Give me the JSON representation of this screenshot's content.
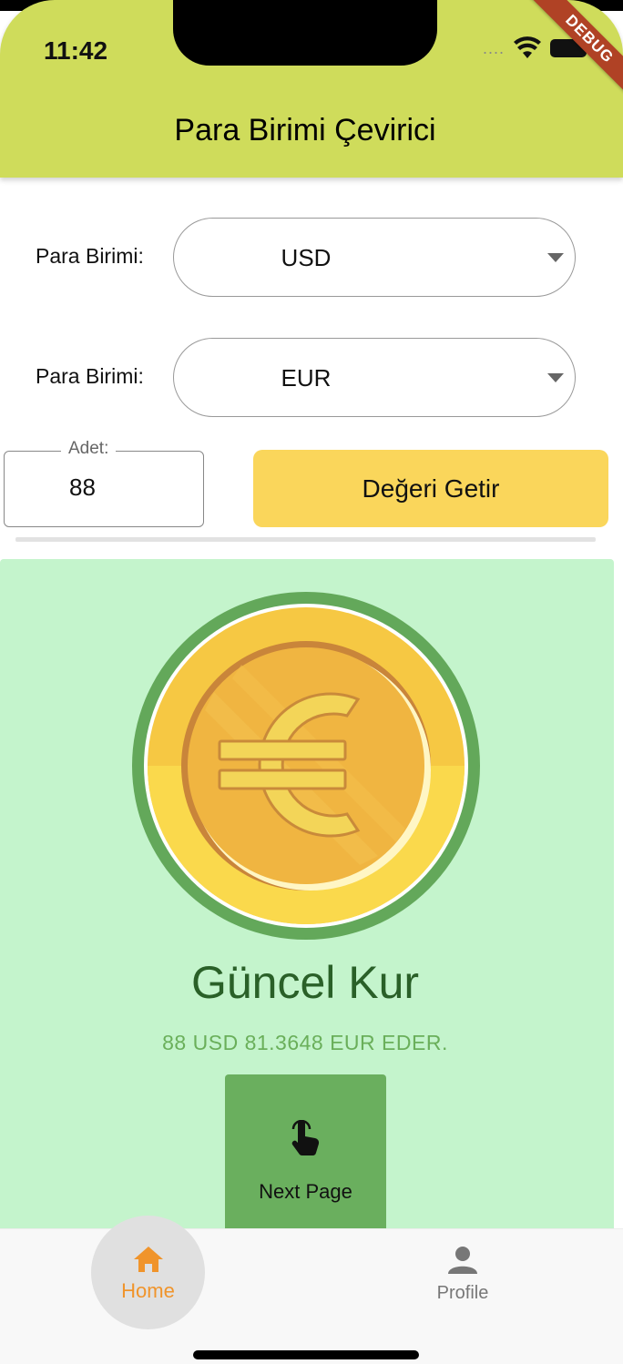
{
  "status_bar": {
    "time": "11:42",
    "signal_dots": "....",
    "debug_banner": "DEBUG"
  },
  "app_bar": {
    "title": "Para Birimi Çevirici"
  },
  "form": {
    "from_label": "Para Birimi:",
    "from_value": "USD",
    "to_label": "Para Birimi:",
    "to_value": "EUR",
    "amount_label": "Adet:",
    "amount_value": "88",
    "fetch_button_label": "Değeri Getir"
  },
  "result": {
    "coin_icon": "euro-coin-icon",
    "title": "Güncel Kur",
    "text": "88 USD 81.3648 EUR EDER.",
    "next_button_label": "Next Page",
    "next_button_icon": "touch-hand-icon"
  },
  "bottom_nav": {
    "items": [
      {
        "label": "Home",
        "icon": "home-icon",
        "active": true
      },
      {
        "label": "Profile",
        "icon": "person-icon",
        "active": false
      }
    ]
  },
  "colors": {
    "app_bar": "#cfdc5b",
    "fetch_button": "#fad65b",
    "result_card": "#c4f4cc",
    "next_button": "#6aaf5e",
    "active_nav": "#f0942b",
    "title_green": "#2a6028"
  }
}
